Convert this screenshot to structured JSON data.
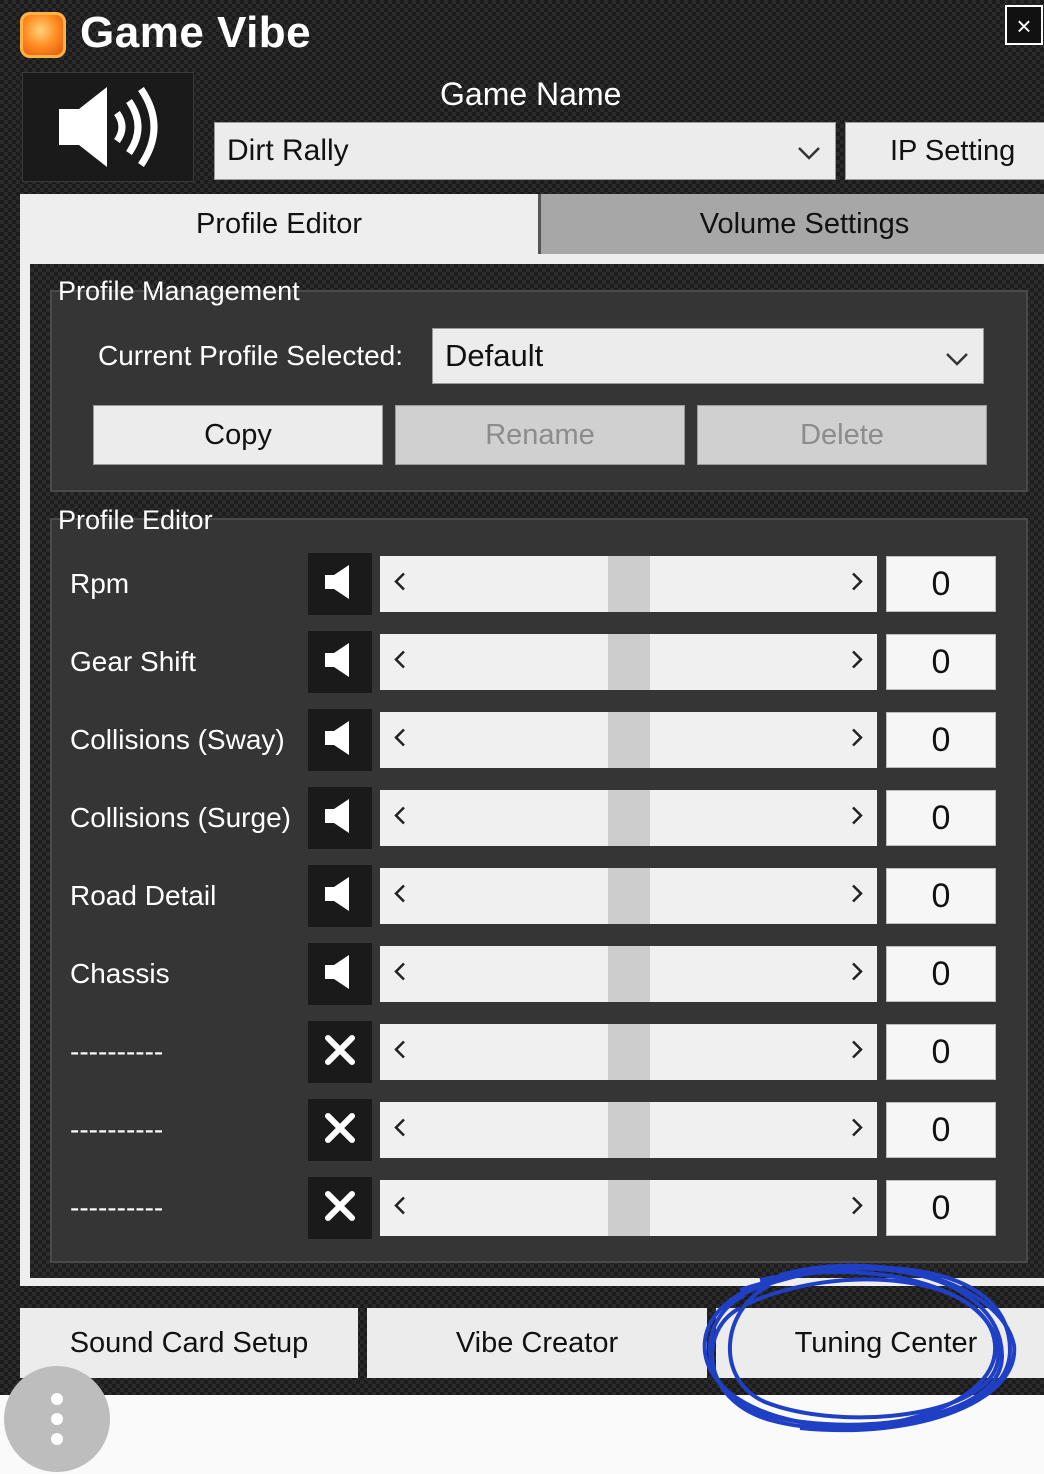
{
  "window": {
    "title_bold": "Game Vibe",
    "title_light": "",
    "close_label": "×"
  },
  "header": {
    "game_name_label": "Game Name",
    "game_selected": "Dirt Rally",
    "ip_button_label": "IP Setting"
  },
  "tabs": [
    {
      "label": "Profile Editor",
      "active": true
    },
    {
      "label": "Volume Settings",
      "active": false
    }
  ],
  "profile_management": {
    "title": "Profile Management",
    "current_profile_label": "Current Profile Selected:",
    "current_profile_value": "Default",
    "buttons": {
      "copy": "Copy",
      "rename": "Rename",
      "delete": "Delete"
    }
  },
  "profile_editor": {
    "title": "Profile Editor",
    "rows": [
      {
        "label": "Rpm",
        "icon": "speaker-icon",
        "value": "0"
      },
      {
        "label": "Gear Shift",
        "icon": "speaker-icon",
        "value": "0"
      },
      {
        "label": "Collisions (Sway)",
        "icon": "speaker-icon",
        "value": "0"
      },
      {
        "label": "Collisions (Surge)",
        "icon": "speaker-icon",
        "value": "0"
      },
      {
        "label": "Road Detail",
        "icon": "speaker-icon",
        "value": "0"
      },
      {
        "label": "Chassis",
        "icon": "speaker-icon",
        "value": "0"
      },
      {
        "label": "----------",
        "icon": "x-icon",
        "value": "0"
      },
      {
        "label": "----------",
        "icon": "x-icon",
        "value": "0"
      },
      {
        "label": "----------",
        "icon": "x-icon",
        "value": "0"
      }
    ]
  },
  "footer": {
    "sound_card_setup": "Sound Card Setup",
    "vibe_creator": "Vibe Creator",
    "tuning_center": "Tuning Center"
  },
  "colors": {
    "annotation": "#1f3fc4",
    "accent_logo": "#ff8a1f"
  }
}
